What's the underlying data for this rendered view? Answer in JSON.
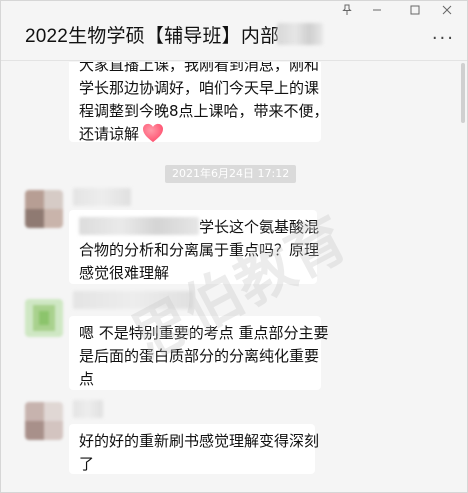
{
  "window": {
    "title": "2022生物学硕【辅导班】内部...",
    "controls": [
      "pin-icon",
      "minimize-icon",
      "maximize-icon",
      "close-icon"
    ],
    "more_label": "···"
  },
  "messages": [
    {
      "sender": "hidden",
      "lines": [
        "大家直播上课，我刚看到消息，刚和",
        "学长那边协调好，咱们今天早上的课",
        "程调整到今晚8点上课哈，带来不便，",
        "还请谅解"
      ],
      "emoji": "heart"
    },
    {
      "timestamp": "2021年6月24日 17:12"
    },
    {
      "sender": "hidden",
      "mention_suffix": "学长这个氨基酸混",
      "lines": [
        "合物的分析和分离属于重点吗？原理",
        "感觉很难理解"
      ]
    },
    {
      "sender": "hidden",
      "lines": [
        "嗯 不是特别重要的考点 重点部分主要",
        "是后面的蛋白质部分的分离纯化重要",
        "点"
      ]
    },
    {
      "sender": "hidden",
      "lines": [
        "好的好的重新刷书感觉理解变得深刻",
        "了"
      ]
    }
  ],
  "watermark": "思伯教育",
  "colors": {
    "background": "#f5f5f5",
    "bubble": "#ffffff",
    "heart": "#ff4d6d",
    "timestamp_bg": "#dadada"
  }
}
